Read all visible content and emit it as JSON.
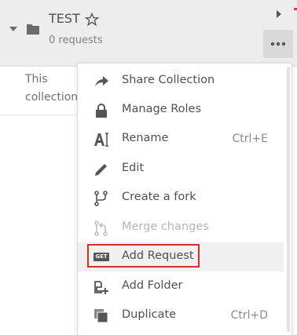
{
  "collection": {
    "name": "TEST",
    "count": "0 requests",
    "description": "This collection"
  },
  "menu": {
    "items": [
      {
        "label": "Share Collection",
        "icon": "share-icon",
        "shortcut": "",
        "disabled": false
      },
      {
        "label": "Manage Roles",
        "icon": "lock-icon",
        "shortcut": "",
        "disabled": false
      },
      {
        "label": "Rename",
        "icon": "rename-icon",
        "shortcut": "Ctrl+E",
        "disabled": false
      },
      {
        "label": "Edit",
        "icon": "pencil-icon",
        "shortcut": "",
        "disabled": false
      },
      {
        "label": "Create a fork",
        "icon": "fork-icon",
        "shortcut": "",
        "disabled": false
      },
      {
        "label": "Merge changes",
        "icon": "merge-icon",
        "shortcut": "",
        "disabled": true
      },
      {
        "label": "Add Request",
        "icon": "get-request-icon",
        "badge": "GET",
        "shortcut": "",
        "disabled": false
      },
      {
        "label": "Add Folder",
        "icon": "add-folder-icon",
        "shortcut": "",
        "disabled": false
      },
      {
        "label": "Duplicate",
        "icon": "duplicate-icon",
        "shortcut": "Ctrl+D",
        "disabled": false
      }
    ]
  },
  "colors": {
    "highlight_border": "#d32f2f",
    "header_bg": "#ededed",
    "text": "#505050"
  }
}
